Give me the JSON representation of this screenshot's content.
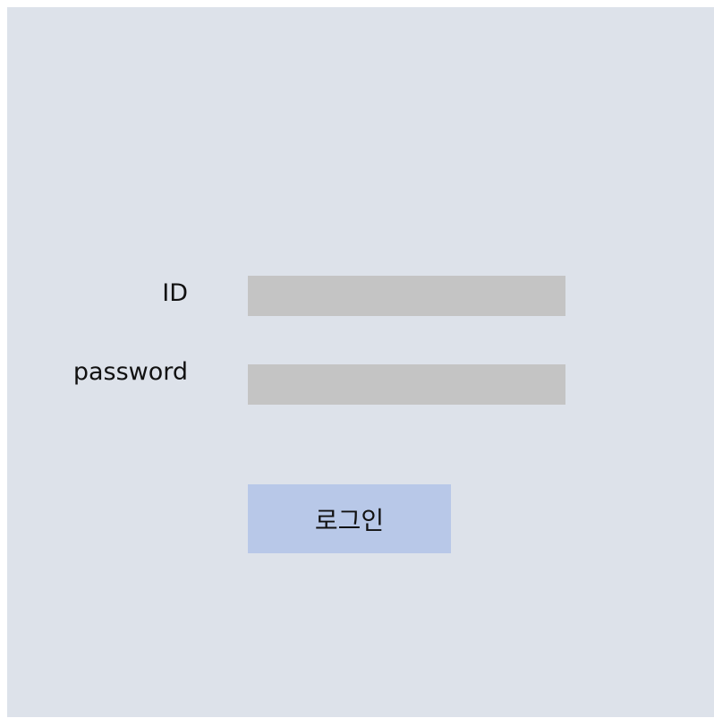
{
  "login_form": {
    "id_label": "ID",
    "id_value": "",
    "password_label": "password",
    "password_value": "",
    "submit_label": "로그인"
  },
  "colors": {
    "background": "#dde2ea",
    "input_fill": "#c4c4c4",
    "button_fill": "#b8c8e8"
  }
}
